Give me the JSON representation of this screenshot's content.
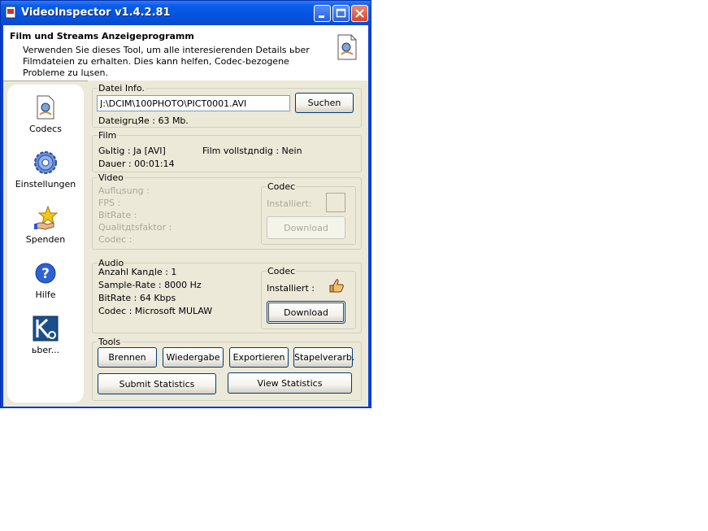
{
  "window": {
    "title": "VideoInspector v1.4.2.81"
  },
  "header": {
    "title": "Film und Streams Anzeigeprogramm",
    "description": "Verwenden Sie dieses Tool, um alle interesierenden Details ьber Filmdateien zu erhalten. Dies kann helfen, Codec-bezogene Probleme zu lцsen."
  },
  "sidebar": {
    "items": [
      {
        "label": "Codecs",
        "icon": "codecs-icon"
      },
      {
        "label": "Einstellungen",
        "icon": "gear-icon"
      },
      {
        "label": "Spenden",
        "icon": "donate-icon"
      },
      {
        "label": "Hilfe",
        "icon": "help-icon"
      },
      {
        "label": "ьber...",
        "icon": "about-icon"
      }
    ]
  },
  "datei": {
    "legend": "Datei Info.",
    "path": "J:\\DCIM\\100PHOTO\\PICT0001.AVI",
    "search_label": "Suchen",
    "size": "DateigrцЯe : 63 Mb."
  },
  "film": {
    "legend": "Film",
    "valid": "Gьltig : Ja [AVI]",
    "complete": "Film vollstдndig : Nein",
    "duration": "Dauer : 00:01:14"
  },
  "video": {
    "legend": "Video",
    "fields": [
      "Auflцsung :",
      "FPS :",
      "BitRate :",
      "Qualitдtsfaktor :",
      "Codec :"
    ],
    "codec": {
      "legend": "Codec",
      "installed": "Installiert:",
      "download": "Download"
    }
  },
  "audio": {
    "legend": "Audio",
    "fields": [
      "Anzahl Kanдle : 1",
      "Sample-Rate : 8000 Hz",
      "BitRate : 64 Kbps",
      "Codec : Microsoft MULAW"
    ],
    "codec": {
      "legend": "Codec",
      "installed": "Installiert :",
      "download": "Download"
    }
  },
  "tools": {
    "legend": "Tools",
    "burn": "Brennen",
    "play": "Wiedergabe",
    "export": "Exportieren",
    "batch": "Stapelverarb.",
    "submit_stats": "Submit Statistics",
    "view_stats": "View Statistics"
  }
}
